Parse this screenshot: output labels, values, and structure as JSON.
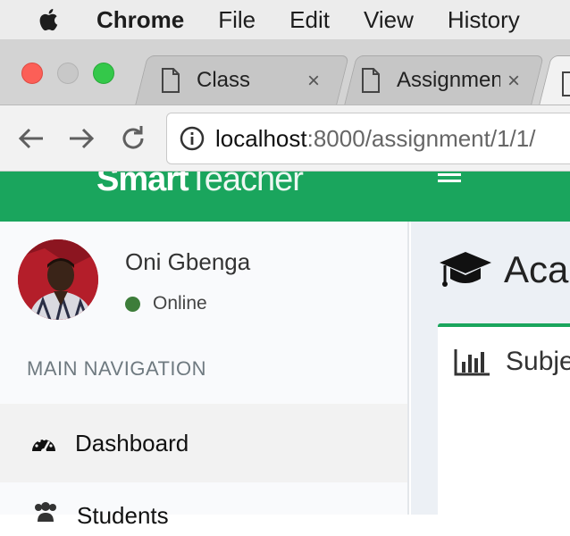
{
  "menubar": {
    "items": [
      "Chrome",
      "File",
      "Edit",
      "View",
      "History"
    ]
  },
  "tabs": [
    {
      "title": "Class",
      "close": "×"
    },
    {
      "title": "Assignment",
      "close": "×"
    }
  ],
  "address": {
    "host": "localhost",
    "rest": ":8000/assignment/1/1/"
  },
  "app": {
    "logo_bold": "Smart",
    "logo_light": "Teacher"
  },
  "user": {
    "name": "Oni Gbenga",
    "status": "Online",
    "status_color": "#3d7d3a"
  },
  "sidebar": {
    "header": "MAIN NAVIGATION",
    "items": [
      {
        "label": "Dashboard",
        "icon": "dashboard-icon",
        "active": true
      },
      {
        "label": "Students",
        "icon": "users-icon"
      }
    ]
  },
  "content": {
    "title": "Academic",
    "box_title": "Subjects"
  },
  "colors": {
    "brand": "#1aa55d",
    "sidebar_bg": "#f9fafc",
    "content_bg": "#ecf0f5"
  }
}
